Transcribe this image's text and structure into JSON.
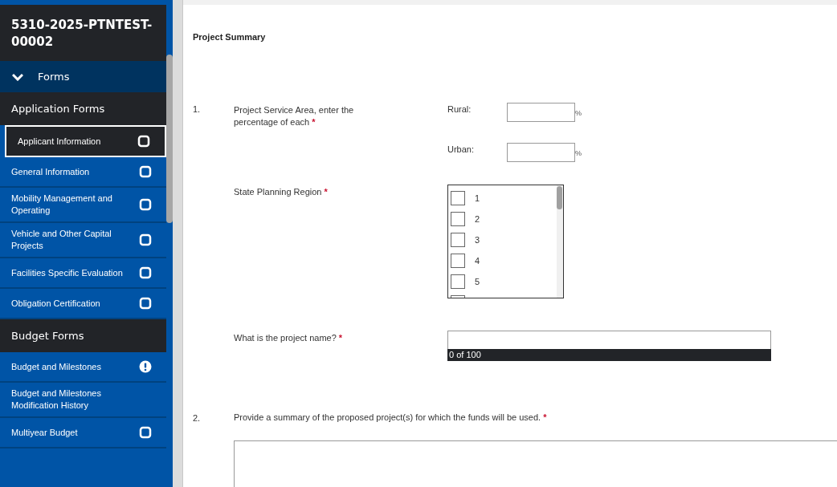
{
  "sidebar": {
    "title": "5310-2025-PTNTEST-00002",
    "forms_toggle": {
      "label": "Forms",
      "expanded": true
    },
    "sections": [
      {
        "heading": "Application Forms",
        "items": [
          {
            "label": "Applicant Information",
            "selected": true,
            "kind": "checkbox"
          },
          {
            "label": "General Information",
            "selected": false,
            "kind": "checkbox"
          },
          {
            "label": "Mobility Management and Operating",
            "selected": false,
            "kind": "checkbox"
          },
          {
            "label": "Vehicle and Other Capital Projects",
            "selected": false,
            "kind": "checkbox"
          },
          {
            "label": "Facilities Specific Evaluation",
            "selected": false,
            "kind": "checkbox"
          },
          {
            "label": "Obligation Certification",
            "selected": false,
            "kind": "checkbox"
          }
        ]
      },
      {
        "heading": "Budget Forms",
        "items": [
          {
            "label": "Budget and Milestones",
            "selected": false,
            "kind": "alert"
          },
          {
            "label": "Budget and Milestones Modification History",
            "selected": false,
            "kind": "plain"
          },
          {
            "label": "Multiyear Budget",
            "selected": false,
            "kind": "checkbox"
          }
        ]
      }
    ]
  },
  "page_title": "Project Summary",
  "questions": [
    {
      "number": "1.",
      "parts": [
        {
          "kind": "percent",
          "question": "Project Service Area, enter the percentage of each",
          "required_mark": "*",
          "fields": [
            {
              "label": "Rural:",
              "unit": "%"
            },
            {
              "label": "Urban:",
              "unit": "%"
            }
          ]
        },
        {
          "kind": "checklist",
          "question": "State Planning Region",
          "required_mark": "*",
          "options": [
            {
              "label": "1",
              "checked": false
            },
            {
              "label": "2",
              "checked": false
            },
            {
              "label": "3",
              "checked": false
            },
            {
              "label": "4",
              "checked": false
            },
            {
              "label": "5",
              "checked": false
            }
          ]
        },
        {
          "kind": "text",
          "question": "What is the project name?",
          "required_mark": "*",
          "counter": "0 of 100"
        }
      ]
    },
    {
      "number": "2.",
      "parts": [
        {
          "kind": "textarea",
          "question": "Provide a summary of the proposed project(s) for which the funds will be used.",
          "required_mark": "*"
        }
      ]
    }
  ]
}
